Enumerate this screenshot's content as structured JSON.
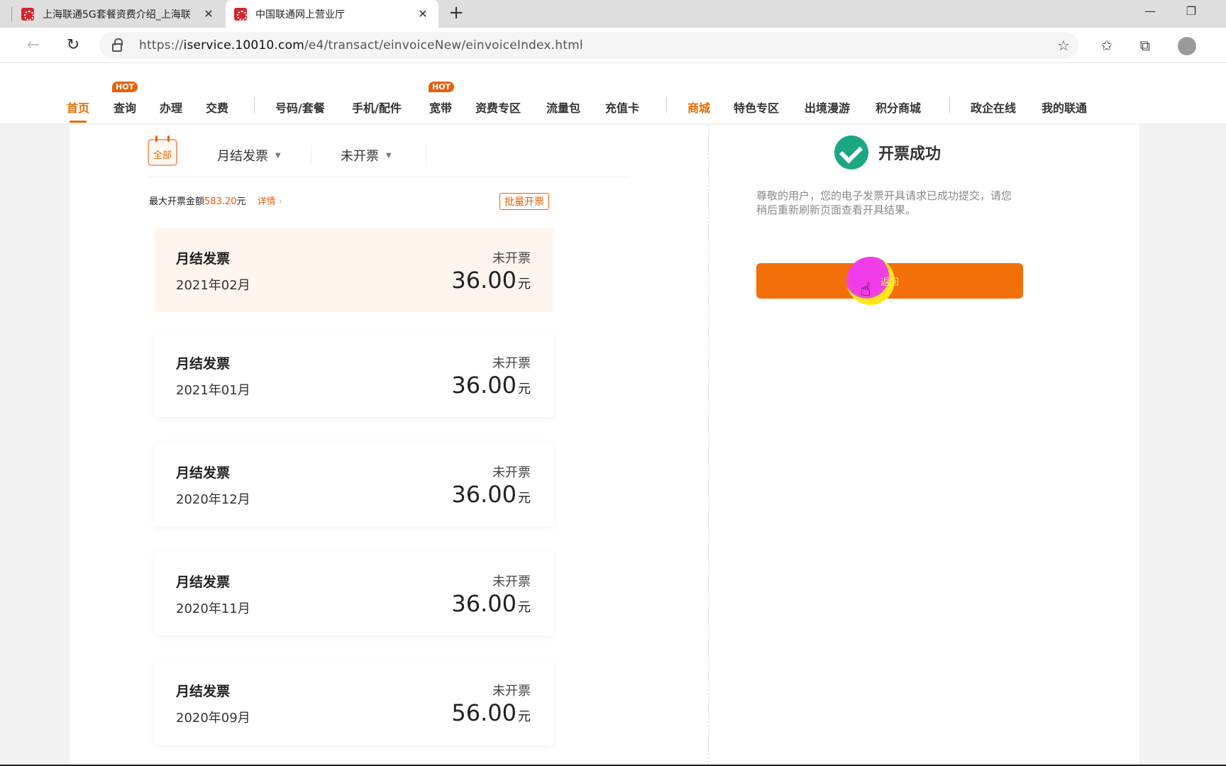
{
  "browser": {
    "tabs": [
      {
        "title": "上海联通5G套餐资费介绍_上海联",
        "active": false
      },
      {
        "title": "中国联通网上营业厅",
        "active": true
      }
    ],
    "new_tab": "+",
    "url_prefix": "https://",
    "url_host": "iservice.10010.com",
    "url_path": "/e4/transact/einvoiceNew/einvoiceIndex.html",
    "window_controls": {
      "minimize": "—",
      "restore": "❐"
    }
  },
  "site_nav": {
    "items": [
      {
        "label": "首页",
        "hot": false
      },
      {
        "label": "查询",
        "hot": true
      },
      {
        "label": "办理",
        "hot": false
      },
      {
        "label": "交费",
        "hot": false
      },
      {
        "label": "号码/套餐",
        "hot": false
      },
      {
        "label": "手机/配件",
        "hot": false
      },
      {
        "label": "宽带",
        "hot": true
      },
      {
        "label": "资费专区",
        "hot": false
      },
      {
        "label": "流量包",
        "hot": false
      },
      {
        "label": "充值卡",
        "hot": false
      },
      {
        "label": "商城",
        "hot": false
      },
      {
        "label": "特色专区",
        "hot": false
      },
      {
        "label": "出境漫游",
        "hot": false
      },
      {
        "label": "积分商城",
        "hot": false
      },
      {
        "label": "政企在线",
        "hot": false
      },
      {
        "label": "我的联通",
        "hot": false
      }
    ],
    "hot_label": "HOT"
  },
  "filter": {
    "calendar_label": "全部",
    "invoice_type": "月结发票",
    "invoice_status": "未开票"
  },
  "summary": {
    "max_label": "最大开票金额",
    "max_amount": "583.20",
    "max_unit": "元",
    "detail_link": "详情",
    "batch_button": "批量开票"
  },
  "invoices": [
    {
      "title": "月结发票",
      "date": "2021年02月",
      "status": "未开票",
      "amount": "36.00",
      "unit": "元"
    },
    {
      "title": "月结发票",
      "date": "2021年01月",
      "status": "未开票",
      "amount": "36.00",
      "unit": "元"
    },
    {
      "title": "月结发票",
      "date": "2020年12月",
      "status": "未开票",
      "amount": "36.00",
      "unit": "元"
    },
    {
      "title": "月结发票",
      "date": "2020年11月",
      "status": "未开票",
      "amount": "36.00",
      "unit": "元"
    },
    {
      "title": "月结发票",
      "date": "2020年09月",
      "status": "未开票",
      "amount": "56.00",
      "unit": "元"
    }
  ],
  "result": {
    "title": "开票成功",
    "description": "尊敬的用户，您的电子发票开具请求已成功提交，请您稍后重新刷新页面查看开具结果。",
    "return_button": "返回"
  },
  "colors": {
    "accent": "#e86c00",
    "button": "#f36f0a",
    "success": "#1aa882"
  }
}
